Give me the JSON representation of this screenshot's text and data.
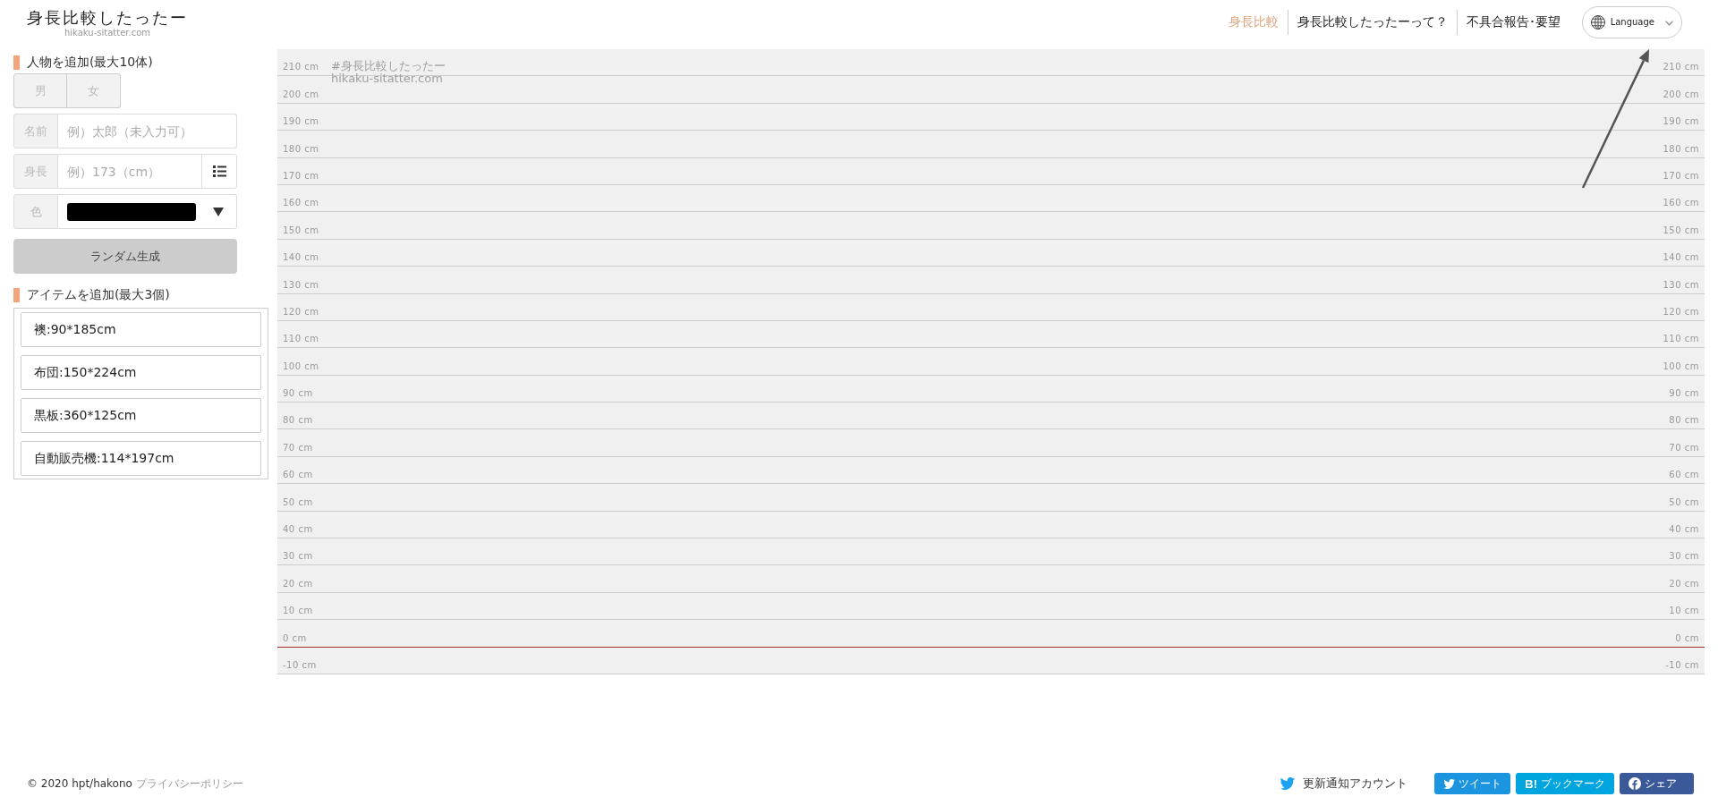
{
  "header": {
    "title": "身長比較したったー",
    "subtitle": "hikaku-sitatter.com",
    "nav": [
      {
        "label": "身長比較",
        "selected": true
      },
      {
        "label": "身長比較したったーって？",
        "selected": false
      },
      {
        "label": "不具合報告･要望",
        "selected": false
      }
    ],
    "language_button": {
      "label": "Language"
    }
  },
  "person_form": {
    "heading": "人物を追加(最大10体)",
    "gender_options": [
      {
        "label": "男",
        "selected": false
      },
      {
        "label": "女",
        "selected": false
      }
    ],
    "fields": [
      {
        "kind": "text",
        "label": "名前",
        "placeholder": "例）太郎（未入力可）"
      },
      {
        "kind": "height",
        "label": "身長",
        "placeholder": "例）173（cm）"
      },
      {
        "kind": "color",
        "label": "色",
        "color": "#000000"
      }
    ],
    "random_button": "ランダム生成"
  },
  "item_form": {
    "heading": "アイテムを追加(最大3個)",
    "items": [
      "襖:90*185cm",
      "布団:150*224cm",
      "黒板:360*125cm",
      "自動販売機:114*197cm"
    ]
  },
  "chart": {
    "watermark_lines": [
      "#身長比較したったー",
      "hikaku-sitatter.com"
    ],
    "rows": [
      {
        "kind": "grid",
        "label_left": "210 cm",
        "label_right": "210 cm"
      },
      {
        "kind": "grid",
        "label_left": "200 cm",
        "label_right": "200 cm"
      },
      {
        "kind": "grid",
        "label_left": "190 cm",
        "label_right": "190 cm"
      },
      {
        "kind": "grid",
        "label_left": "180 cm",
        "label_right": "180 cm"
      },
      {
        "kind": "grid",
        "label_left": "170 cm",
        "label_right": "170 cm"
      },
      {
        "kind": "grid",
        "label_left": "160 cm",
        "label_right": "160 cm"
      },
      {
        "kind": "grid",
        "label_left": "150 cm",
        "label_right": "150 cm"
      },
      {
        "kind": "grid",
        "label_left": "140 cm",
        "label_right": "140 cm"
      },
      {
        "kind": "grid",
        "label_left": "130 cm",
        "label_right": "130 cm"
      },
      {
        "kind": "grid",
        "label_left": "120 cm",
        "label_right": "120 cm"
      },
      {
        "kind": "grid",
        "label_left": "110 cm",
        "label_right": "110 cm"
      },
      {
        "kind": "grid",
        "label_left": "100 cm",
        "label_right": "100 cm"
      },
      {
        "kind": "grid",
        "label_left": "90 cm",
        "label_right": "90 cm"
      },
      {
        "kind": "grid",
        "label_left": "80 cm",
        "label_right": "80 cm"
      },
      {
        "kind": "grid",
        "label_left": "70 cm",
        "label_right": "70 cm"
      },
      {
        "kind": "grid",
        "label_left": "60 cm",
        "label_right": "60 cm"
      },
      {
        "kind": "grid",
        "label_left": "50 cm",
        "label_right": "50 cm"
      },
      {
        "kind": "grid",
        "label_left": "40 cm",
        "label_right": "40 cm"
      },
      {
        "kind": "grid",
        "label_left": "30 cm",
        "label_right": "30 cm"
      },
      {
        "kind": "grid",
        "label_left": "20 cm",
        "label_right": "20 cm"
      },
      {
        "kind": "grid",
        "label_left": "10 cm",
        "label_right": "10 cm"
      },
      {
        "kind": "ground",
        "label_left": "0 cm",
        "label_right": "0 cm"
      },
      {
        "kind": "grid",
        "label_left": "-10 cm",
        "label_right": "-10 cm"
      }
    ]
  },
  "footer": {
    "copyright": "© 2020 hpt/hakono",
    "privacy_link": "プライバシーポリシー",
    "follow_link": "更新通知アカウント",
    "share_buttons": [
      {
        "kind": "twitter",
        "label": "ツイート"
      },
      {
        "kind": "hatena",
        "logo": "B!",
        "label": "ブックマーク"
      },
      {
        "kind": "facebook",
        "label": "シェア"
      }
    ]
  }
}
